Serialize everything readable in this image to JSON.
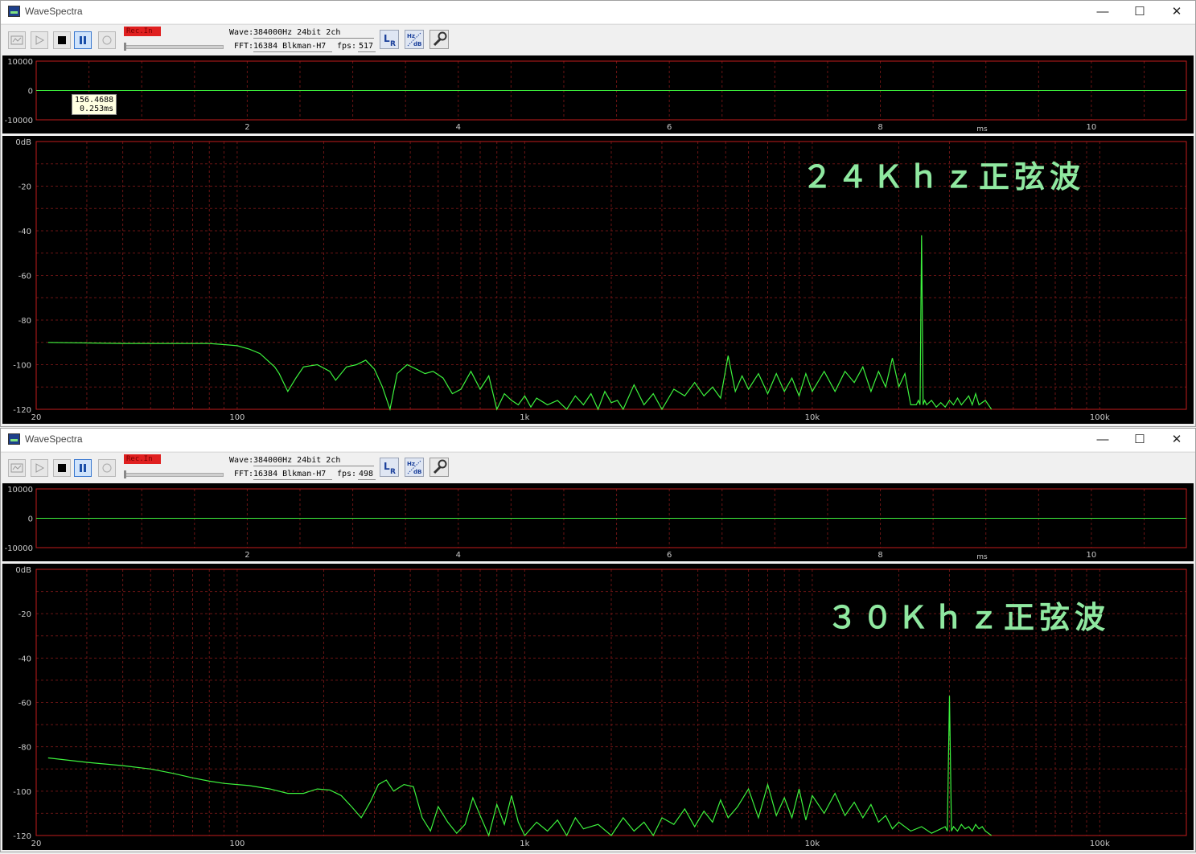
{
  "app_title": "WaveSpectra",
  "window_controls": {
    "minimize": "—",
    "maximize": "☐",
    "close": "✕"
  },
  "rec_label": "Rec.In",
  "labels": {
    "wave": "Wave:",
    "fft": "FFT:",
    "fps": "fps:"
  },
  "colors": {
    "trace": "#3df23d",
    "grid": "#6a1414",
    "frame": "#c21c1c",
    "axis_text": "#c8c8c8",
    "overlay": "#8fe8a0"
  },
  "icons": [
    "wave-icon",
    "play-icon",
    "stop-icon",
    "pause-icon",
    "record-icon",
    "lr-channel-icon",
    "hz-db-icon",
    "settings-wrench-icon"
  ],
  "windows": [
    {
      "wave_format": "384000Hz 24bit 2ch",
      "fft_settings": "16384 Blkman-H7",
      "fps_value": "517",
      "overlay_label": "２４Ｋｈｚ正弦波",
      "tooltip": {
        "value": "156.4688",
        "time": "0.253ms"
      },
      "chart_data": {
        "type": "line",
        "xscale": "log",
        "xlim": [
          20,
          200000
        ],
        "ylim": [
          -120,
          0
        ],
        "x_ticks": [
          "20",
          "100",
          "1k",
          "10k",
          "100k"
        ],
        "y_ticks": [
          "0dB",
          "-20",
          "-40",
          "-60",
          "-80",
          "-100",
          "-120"
        ],
        "series": [
          {
            "x": [
              22,
              40,
              60,
              80,
              90,
              100,
              110,
              120,
              135,
              140,
              150,
              160,
              170,
              190,
              210,
              220,
              240,
              260,
              280,
              300,
              320,
              340,
              360,
              390,
              420,
              450,
              480,
              520,
              560,
              600,
              650,
              700,
              750,
              800,
              850,
              900,
              950,
              1000,
              1050,
              1100,
              1200,
              1300,
              1400,
              1500,
              1600,
              1700,
              1800,
              1900,
              2000,
              2100,
              2200,
              2400,
              2600,
              2800,
              3000,
              3300,
              3600,
              3900,
              4200,
              4500,
              4800,
              5100,
              5400,
              5700,
              6000,
              6500,
              7000,
              7500,
              8000,
              8500,
              9000,
              9500,
              10000,
              11000,
              12000,
              13000,
              14000,
              15000,
              16000,
              17000,
              18000,
              19000,
              20000,
              21000,
              22000,
              23000,
              23400,
              23700,
              24000,
              24300,
              24600,
              25000,
              26000,
              27000,
              28000,
              29000,
              30000,
              31000,
              32000,
              33000,
              34000,
              35000,
              36000,
              37000,
              38000,
              40000,
              42000
            ],
            "y": [
              -90,
              -90.5,
              -90.5,
              -90.5,
              -91,
              -91.5,
              -93,
              -95,
              -101,
              -104,
              -112,
              -106,
              -101,
              -100,
              -103,
              -107,
              -101,
              -100,
              -98,
              -102,
              -110,
              -120,
              -104,
              -100,
              -102,
              -104,
              -103,
              -106,
              -113,
              -111,
              -103,
              -111,
              -105,
              -120,
              -113,
              -116,
              -118,
              -114,
              -119,
              -115,
              -118,
              -116,
              -120,
              -114,
              -118,
              -113,
              -120,
              -112,
              -117,
              -116,
              -120,
              -109,
              -118,
              -113,
              -120,
              -111,
              -114,
              -108,
              -114,
              -110,
              -115,
              -96,
              -112,
              -105,
              -111,
              -104,
              -113,
              -104,
              -112,
              -106,
              -114,
              -104,
              -112,
              -103,
              -112,
              -103,
              -108,
              -101,
              -112,
              -103,
              -110,
              -97,
              -110,
              -104,
              -118,
              -118,
              -116,
              -118,
              -42,
              -118,
              -116,
              -118,
              -116,
              -119,
              -117,
              -119,
              -116,
              -118,
              -115,
              -118,
              -116,
              -114,
              -118,
              -113,
              -118,
              -116,
              -120
            ]
          }
        ]
      }
    },
    {
      "wave_format": "384000Hz 24bit 2ch",
      "fft_settings": "16384 Blkman-H7",
      "fps_value": "498",
      "overlay_label": "３０Ｋｈｚ正弦波",
      "chart_data": {
        "type": "line",
        "xscale": "log",
        "xlim": [
          20,
          200000
        ],
        "ylim": [
          -120,
          0
        ],
        "x_ticks": [
          "20",
          "100",
          "1k",
          "10k",
          "100k"
        ],
        "y_ticks": [
          "0dB",
          "-20",
          "-40",
          "-60",
          "-80",
          "-100",
          "-120"
        ],
        "series": [
          {
            "x": [
              22,
              30,
              40,
              50,
              60,
              70,
              80,
              90,
              100,
              110,
              130,
              150,
              170,
              190,
              210,
              230,
              250,
              270,
              290,
              310,
              330,
              350,
              380,
              410,
              440,
              470,
              500,
              540,
              580,
              620,
              660,
              700,
              750,
              800,
              850,
              900,
              950,
              1000,
              1100,
              1200,
              1300,
              1400,
              1500,
              1600,
              1800,
              2000,
              2200,
              2400,
              2600,
              2800,
              3000,
              3300,
              3600,
              3900,
              4200,
              4500,
              4800,
              5100,
              5500,
              6000,
              6500,
              7000,
              7500,
              8000,
              8500,
              9000,
              9500,
              10000,
              11000,
              12000,
              13000,
              14000,
              15000,
              16000,
              17000,
              18000,
              19000,
              20000,
              22000,
              24000,
              26000,
              28000,
              29000,
              29500,
              30000,
              30500,
              31000,
              32000,
              33000,
              34000,
              35000,
              36000,
              37000,
              38000,
              39000,
              40000,
              42000
            ],
            "y": [
              -85,
              -87,
              -88.5,
              -90,
              -92,
              -94,
              -95.5,
              -96.5,
              -97,
              -97.5,
              -99,
              -101,
              -101,
              -99,
              -99.5,
              -102,
              -107,
              -112,
              -105,
              -97,
              -95,
              -100,
              -97,
              -98,
              -112,
              -118,
              -107,
              -114,
              -119,
              -115,
              -103,
              -111,
              -120,
              -106,
              -115,
              -102,
              -114,
              -120,
              -114,
              -118,
              -113,
              -120,
              -112,
              -117,
              -115,
              -120,
              -112,
              -118,
              -114,
              -120,
              -112,
              -115,
              -108,
              -116,
              -109,
              -114,
              -104,
              -112,
              -107,
              -99,
              -112,
              -97,
              -111,
              -103,
              -112,
              -99,
              -113,
              -102,
              -110,
              -101,
              -111,
              -105,
              -112,
              -106,
              -114,
              -111,
              -117,
              -114,
              -118,
              -116,
              -119,
              -117,
              -116,
              -118,
              -57,
              -118,
              -116,
              -118,
              -115,
              -117,
              -116,
              -118,
              -115,
              -117,
              -116,
              -118,
              -120
            ]
          }
        ]
      }
    }
  ],
  "wave_axis": {
    "y_ticks": [
      "10000",
      "0",
      "-10000"
    ],
    "x_ticks": [
      "2",
      "4",
      "6",
      "8",
      "10"
    ],
    "x_unit": "ms",
    "xlim": [
      0,
      10.9
    ]
  }
}
